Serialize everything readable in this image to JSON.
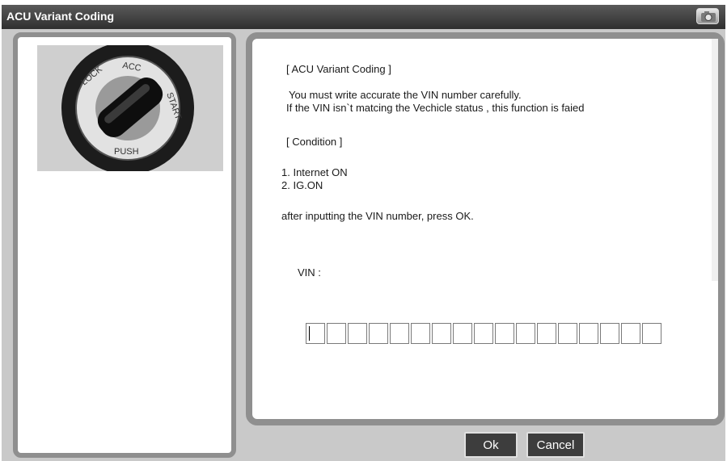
{
  "window": {
    "title": "ACU Variant Coding",
    "camera_icon": "camera-icon"
  },
  "content": {
    "heading": "[ ACU Variant Coding ]",
    "warning_line1": "You must write accurate  the VIN number carefully.",
    "warning_line2": "If the VIN isn`t matcing the Vechicle status , this function is faied",
    "condition_heading": "[ Condition ]",
    "condition_1": "1. Internet ON",
    "condition_2": "2. IG.ON",
    "instruction": "after inputting the VIN number, press OK.",
    "vin_label": "VIN :",
    "vin_value": ""
  },
  "buttons": {
    "ok_label": "Ok",
    "cancel_label": "Cancel"
  },
  "image": {
    "icon": "ignition-key-switch"
  }
}
